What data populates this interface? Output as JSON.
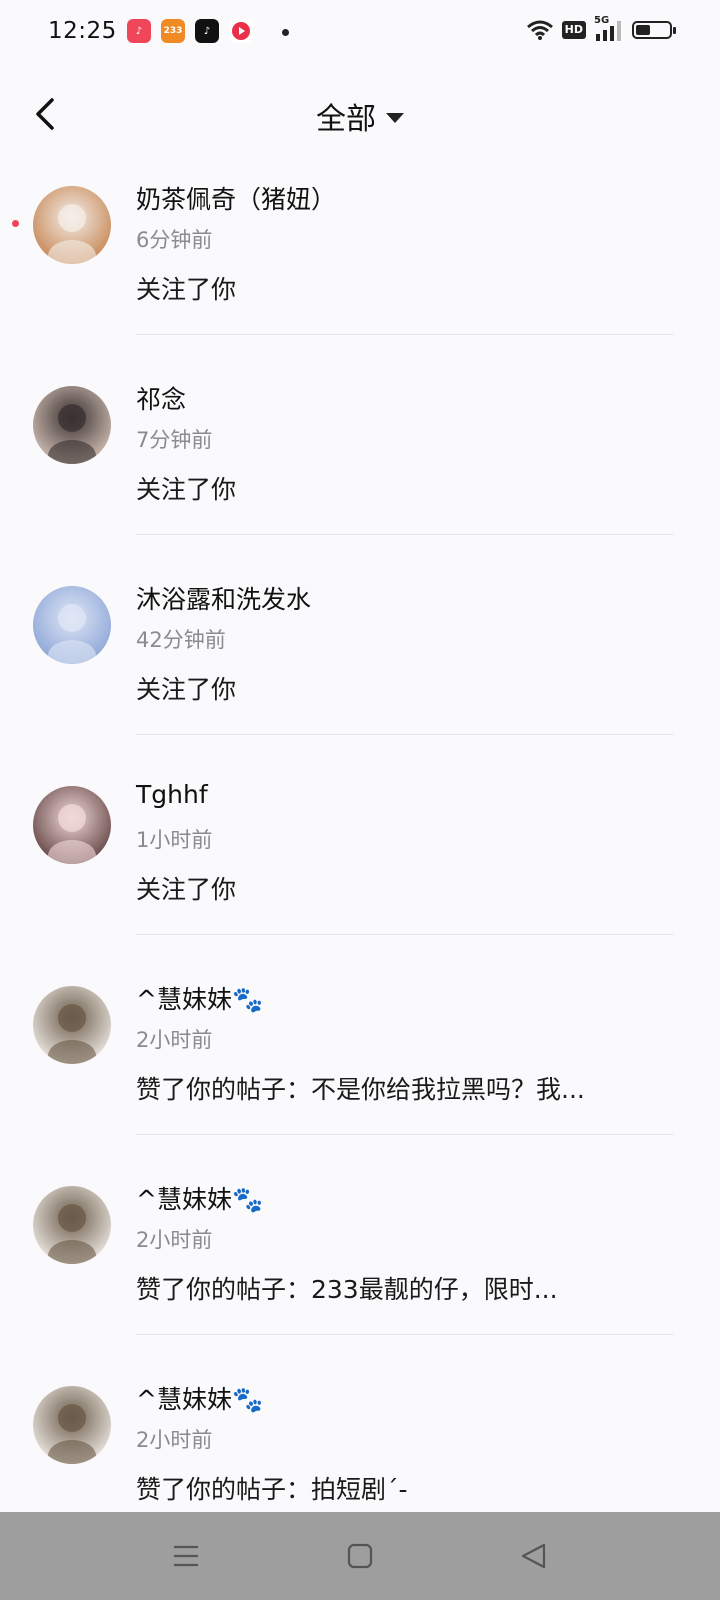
{
  "status_bar": {
    "time": "12:25",
    "app_icons": [
      {
        "name": "music-app-icon",
        "color": "#f0465a",
        "glyph": "♪"
      },
      {
        "name": "app-233-icon",
        "color": "#f08a24",
        "glyph": "233"
      },
      {
        "name": "tiktok-icon",
        "color": "#111111",
        "glyph": "♪"
      },
      {
        "name": "video-app-icon",
        "color": "#ffffff",
        "glyph": "▶"
      }
    ],
    "hd": "HD",
    "network": "5G",
    "battery_level": 0.45
  },
  "header": {
    "title": "全部"
  },
  "notifications": [
    {
      "name": "奶茶佩奇（猪妞）",
      "time": "6分钟前",
      "action": "关注了你",
      "unread": true,
      "avatar_colors": [
        "#f4eee8",
        "#c88a5a"
      ]
    },
    {
      "name": "祁念",
      "time": "7分钟前",
      "action": "关注了你",
      "unread": false,
      "avatar_colors": [
        "#3a3030",
        "#c9b8ae"
      ]
    },
    {
      "name": "沐浴露和洗发水",
      "time": "42分钟前",
      "action": "关注了你",
      "unread": false,
      "avatar_colors": [
        "#dfe6f5",
        "#8fa8d8"
      ]
    },
    {
      "name": "Tghhf",
      "time": "1小时前",
      "action": "关注了你",
      "unread": false,
      "avatar_colors": [
        "#f1dada",
        "#6a4a4a"
      ]
    },
    {
      "name": "^慧妹妹🐾",
      "time": "2小时前",
      "action": "赞了你的帖子：不是你给我拉黑吗？我...",
      "unread": false,
      "avatar_colors": [
        "#6a5a48",
        "#e7e2dc"
      ]
    },
    {
      "name": "^慧妹妹🐾",
      "time": "2小时前",
      "action": "赞了你的帖子：233最靓的仔，限时...",
      "unread": false,
      "avatar_colors": [
        "#6a5a48",
        "#e7e2dc"
      ]
    },
    {
      "name": "^慧妹妹🐾",
      "time": "2小时前",
      "action": "赞了你的帖子：拍短剧´-",
      "unread": false,
      "avatar_colors": [
        "#6a5a48",
        "#e7e2dc"
      ]
    }
  ],
  "system_nav": {
    "icons": [
      "menu-icon",
      "home-square-icon",
      "back-triangle-icon"
    ]
  }
}
